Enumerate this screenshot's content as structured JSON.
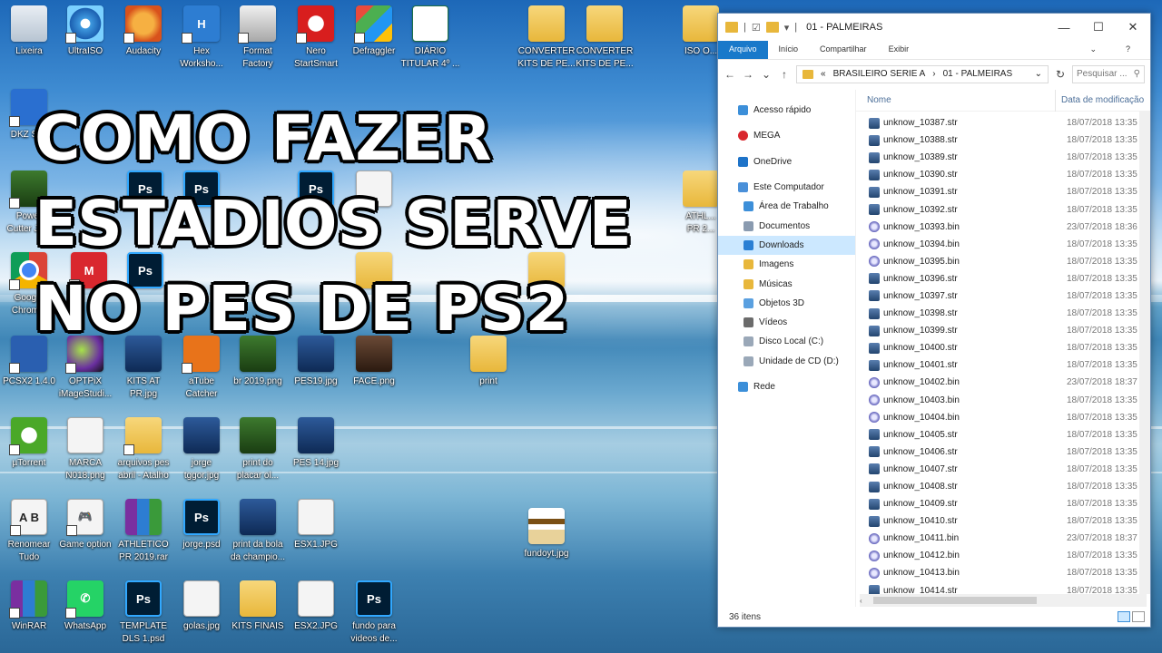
{
  "headline": {
    "line1": "COMO FAZER",
    "line2": "ESTADIOS SERVE",
    "line3": "NO PES DE PS2"
  },
  "desktop_icons": [
    {
      "label": "Lixeira",
      "icon": "recycle-bin-icon"
    },
    {
      "label": "UltraISO",
      "icon": "disc-icon"
    },
    {
      "label": "Audacity",
      "icon": "audacity-icon"
    },
    {
      "label": "Hex\nWorksho...",
      "icon": "hex-icon"
    },
    {
      "label": "Format\nFactory",
      "icon": "format-factory-icon"
    },
    {
      "label": "Nero\nStartSmart",
      "icon": "nero-icon"
    },
    {
      "label": "Defraggler",
      "icon": "defraggler-icon"
    },
    {
      "label": "DIÁRIO\nTITULAR 4º ...",
      "icon": "excel-icon"
    },
    {
      "label": "CONVERTER\nKITS DE PE...",
      "icon": "folder-icon"
    },
    {
      "label": "CONVERTER\nKITS DE PE...",
      "icon": "folder-icon"
    },
    {
      "label": "ISO O...",
      "icon": "folder-icon"
    },
    {
      "label": "DKZ St...",
      "icon": "app-icon"
    },
    {
      "label": "Power\nCutter Jo...",
      "icon": "app-icon"
    },
    {
      "label": "Goog...\nChrom...",
      "icon": "chrome-icon"
    },
    {
      "label": "PCSX2 1.4.0",
      "icon": "pcsx2-icon"
    },
    {
      "label": "OPTPiX\niMageStudi...",
      "icon": "optpix-icon"
    },
    {
      "label": "KITS AT\nPR.jpg",
      "icon": "image-icon"
    },
    {
      "label": "aTube\nCatcher",
      "icon": "atube-icon"
    },
    {
      "label": "br 2019.png",
      "icon": "image-icon"
    },
    {
      "label": "PES19.jpg",
      "icon": "image-icon"
    },
    {
      "label": "FACE.png",
      "icon": "image-icon"
    },
    {
      "label": "print",
      "icon": "folder-icon"
    },
    {
      "label": "ATHL...\nPR 2...",
      "icon": "folder-icon"
    },
    {
      "label": "µTorrent",
      "icon": "utorrent-icon"
    },
    {
      "label": "MARCA\nN018.png",
      "icon": "image-icon"
    },
    {
      "label": "arquivos pes\nabril - Atalho",
      "icon": "folder-icon"
    },
    {
      "label": "jorge\ntggor.jpg",
      "icon": "image-icon"
    },
    {
      "label": "print do\nplacar ol...",
      "icon": "image-icon"
    },
    {
      "label": "PES 14.jpg",
      "icon": "image-icon"
    },
    {
      "label": "Renomear\nTudo",
      "icon": "rename-icon"
    },
    {
      "label": "Game option",
      "icon": "gamepad-icon"
    },
    {
      "label": "ATHLETICO\nPR 2019.rar",
      "icon": "rar-icon"
    },
    {
      "label": "jorge.psd",
      "icon": "photoshop-icon"
    },
    {
      "label": "print da bola\nda champio...",
      "icon": "image-icon"
    },
    {
      "label": "ESX1.JPG",
      "icon": "image-icon"
    },
    {
      "label": "fundoyt.jpg",
      "icon": "image-icon"
    },
    {
      "label": "WinRAR",
      "icon": "rar-icon"
    },
    {
      "label": "WhatsApp",
      "icon": "whatsapp-icon"
    },
    {
      "label": "TEMPLATE\nDLS 1.psd",
      "icon": "photoshop-icon"
    },
    {
      "label": "golas.jpg",
      "icon": "image-icon"
    },
    {
      "label": "KITS FINAIS",
      "icon": "folder-icon"
    },
    {
      "label": "ESX2.JPG",
      "icon": "image-icon"
    },
    {
      "label": "fundo para\nvideos de...",
      "icon": "photoshop-icon"
    }
  ],
  "explorer": {
    "title": "01 - PALMEIRAS",
    "ribbon_tabs": [
      "Arquivo",
      "Início",
      "Compartilhar",
      "Exibir"
    ],
    "address": {
      "root": "«",
      "crumbs": [
        "BRASILEIRO SERIE A",
        "01 - PALMEIRAS"
      ]
    },
    "search_placeholder": "Pesquisar ...",
    "columns": {
      "name": "Nome",
      "date": "Data de modificação"
    },
    "nav": [
      {
        "label": "Acesso rápido",
        "icon": "star-icon",
        "color": "#3c8fd9"
      },
      {
        "label": "MEGA",
        "icon": "mega-icon",
        "color": "#d9272e"
      },
      {
        "label": "OneDrive",
        "icon": "cloud-icon",
        "color": "#1e73c8"
      },
      {
        "label": "Este Computador",
        "icon": "computer-icon",
        "color": "#4a90d9"
      },
      {
        "label": "Área de Trabalho",
        "icon": "folder-icon",
        "color": "#3c8fd9"
      },
      {
        "label": "Documentos",
        "icon": "documents-icon",
        "color": "#8a9bb0"
      },
      {
        "label": "Downloads",
        "icon": "download-icon",
        "color": "#2a7fd4"
      },
      {
        "label": "Imagens",
        "icon": "images-icon",
        "color": "#e8b73b"
      },
      {
        "label": "Músicas",
        "icon": "music-icon",
        "color": "#e8b73b"
      },
      {
        "label": "Objetos 3D",
        "icon": "cube-icon",
        "color": "#5aa0e0"
      },
      {
        "label": "Vídeos",
        "icon": "video-icon",
        "color": "#6b6b6b"
      },
      {
        "label": "Disco Local (C:)",
        "icon": "drive-icon",
        "color": "#9aa8b8"
      },
      {
        "label": "Unidade de CD (D:)",
        "icon": "cd-drive-icon",
        "color": "#9aa8b8"
      },
      {
        "label": "Rede",
        "icon": "network-icon",
        "color": "#3c8fd9"
      }
    ],
    "selected_nav": "Downloads",
    "files": [
      {
        "name": "unknow_10387.str",
        "date": "18/07/2018 13:35",
        "type": "str"
      },
      {
        "name": "unknow_10388.str",
        "date": "18/07/2018 13:35",
        "type": "str"
      },
      {
        "name": "unknow_10389.str",
        "date": "18/07/2018 13:35",
        "type": "str"
      },
      {
        "name": "unknow_10390.str",
        "date": "18/07/2018 13:35",
        "type": "str"
      },
      {
        "name": "unknow_10391.str",
        "date": "18/07/2018 13:35",
        "type": "str"
      },
      {
        "name": "unknow_10392.str",
        "date": "18/07/2018 13:35",
        "type": "str"
      },
      {
        "name": "unknow_10393.bin",
        "date": "23/07/2018 18:36",
        "type": "bin"
      },
      {
        "name": "unknow_10394.bin",
        "date": "18/07/2018 13:35",
        "type": "bin"
      },
      {
        "name": "unknow_10395.bin",
        "date": "18/07/2018 13:35",
        "type": "bin"
      },
      {
        "name": "unknow_10396.str",
        "date": "18/07/2018 13:35",
        "type": "str"
      },
      {
        "name": "unknow_10397.str",
        "date": "18/07/2018 13:35",
        "type": "str"
      },
      {
        "name": "unknow_10398.str",
        "date": "18/07/2018 13:35",
        "type": "str"
      },
      {
        "name": "unknow_10399.str",
        "date": "18/07/2018 13:35",
        "type": "str"
      },
      {
        "name": "unknow_10400.str",
        "date": "18/07/2018 13:35",
        "type": "str"
      },
      {
        "name": "unknow_10401.str",
        "date": "18/07/2018 13:35",
        "type": "str"
      },
      {
        "name": "unknow_10402.bin",
        "date": "23/07/2018 18:37",
        "type": "bin"
      },
      {
        "name": "unknow_10403.bin",
        "date": "18/07/2018 13:35",
        "type": "bin"
      },
      {
        "name": "unknow_10404.bin",
        "date": "18/07/2018 13:35",
        "type": "bin"
      },
      {
        "name": "unknow_10405.str",
        "date": "18/07/2018 13:35",
        "type": "str"
      },
      {
        "name": "unknow_10406.str",
        "date": "18/07/2018 13:35",
        "type": "str"
      },
      {
        "name": "unknow_10407.str",
        "date": "18/07/2018 13:35",
        "type": "str"
      },
      {
        "name": "unknow_10408.str",
        "date": "18/07/2018 13:35",
        "type": "str"
      },
      {
        "name": "unknow_10409.str",
        "date": "18/07/2018 13:35",
        "type": "str"
      },
      {
        "name": "unknow_10410.str",
        "date": "18/07/2018 13:35",
        "type": "str"
      },
      {
        "name": "unknow_10411.bin",
        "date": "23/07/2018 18:37",
        "type": "bin"
      },
      {
        "name": "unknow_10412.bin",
        "date": "18/07/2018 13:35",
        "type": "bin"
      },
      {
        "name": "unknow_10413.bin",
        "date": "18/07/2018 13:35",
        "type": "bin"
      },
      {
        "name": "unknow_10414.str",
        "date": "18/07/2018 13:35",
        "type": "str"
      }
    ],
    "status_text": "36 itens"
  }
}
